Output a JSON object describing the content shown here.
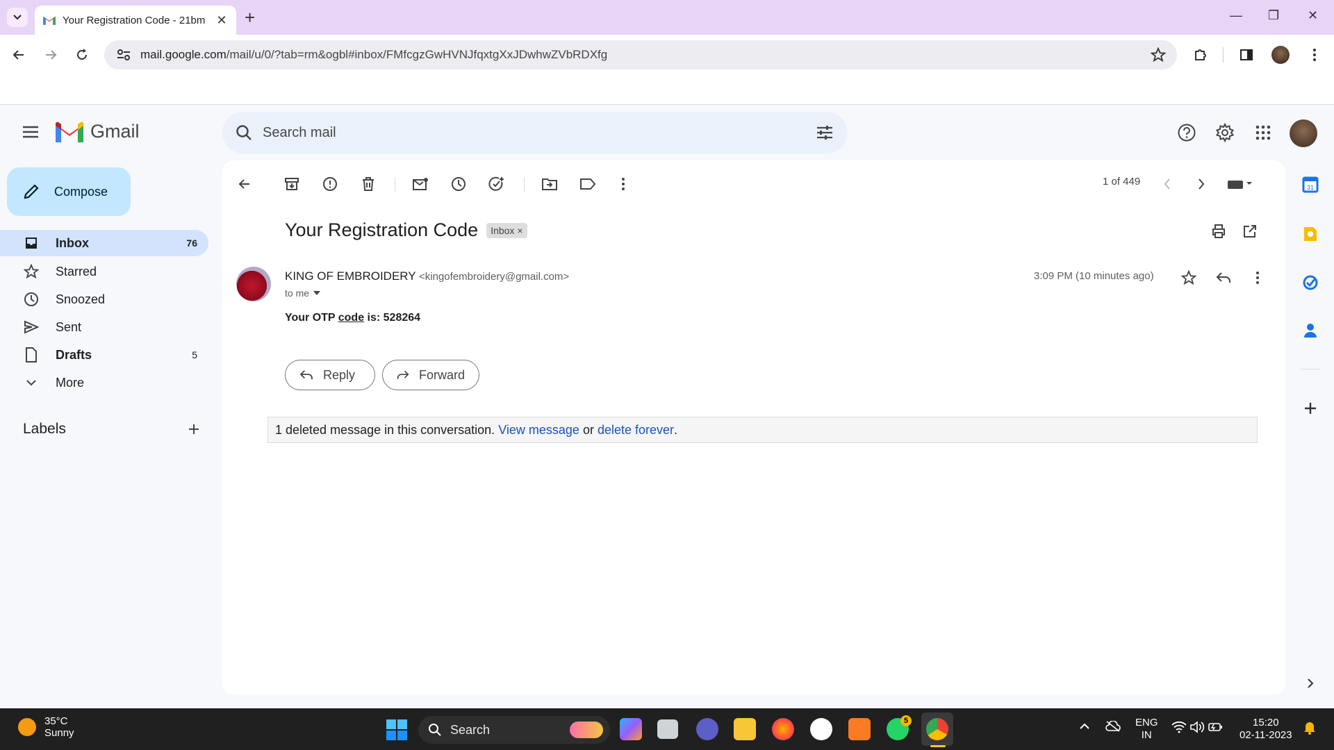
{
  "browser": {
    "tab_title": "Your Registration Code - 21bm",
    "url_host": "mail.google.com",
    "url_path": "/mail/u/0/?tab=rm&ogbl#inbox/FMfcgzGwHVNJfqxtgXxJDwhwZVbRDXfg"
  },
  "gmail": {
    "app_name": "Gmail",
    "search_placeholder": "Search mail",
    "compose_label": "Compose",
    "nav": [
      {
        "label": "Inbox",
        "count": "76"
      },
      {
        "label": "Starred",
        "count": ""
      },
      {
        "label": "Snoozed",
        "count": ""
      },
      {
        "label": "Sent",
        "count": ""
      },
      {
        "label": "Drafts",
        "count": "5"
      },
      {
        "label": "More",
        "count": ""
      }
    ],
    "labels_title": "Labels",
    "pager": "1 of 449",
    "subject": "Your Registration Code",
    "subject_chip": "Inbox",
    "sender_name": "KING OF EMBROIDERY",
    "sender_email": "<kingofembroidery@gmail.com>",
    "to_line": "to me",
    "time": "3:09 PM (10 minutes ago)",
    "body_prefix": "Your OTP ",
    "body_link": "code",
    "body_suffix": " is: 528264",
    "reply_label": "Reply",
    "forward_label": "Forward",
    "deleted_text": "1 deleted message in this conversation.",
    "view_message": "View message",
    "or_text": " or ",
    "delete_forever": "delete forever",
    "period": "."
  },
  "taskbar": {
    "temperature": "35°C",
    "condition": "Sunny",
    "search_label": "Search",
    "lang_line1": "ENG",
    "lang_line2": "IN",
    "clock_time": "15:20",
    "clock_date": "02-11-2023",
    "whatsapp_badge": "5"
  },
  "colors": {
    "accent": "#0b57d0",
    "compose_bg": "#c2e7ff",
    "active_nav": "#d3e3fd",
    "chrome_tabbar": "#e8d4f7"
  }
}
